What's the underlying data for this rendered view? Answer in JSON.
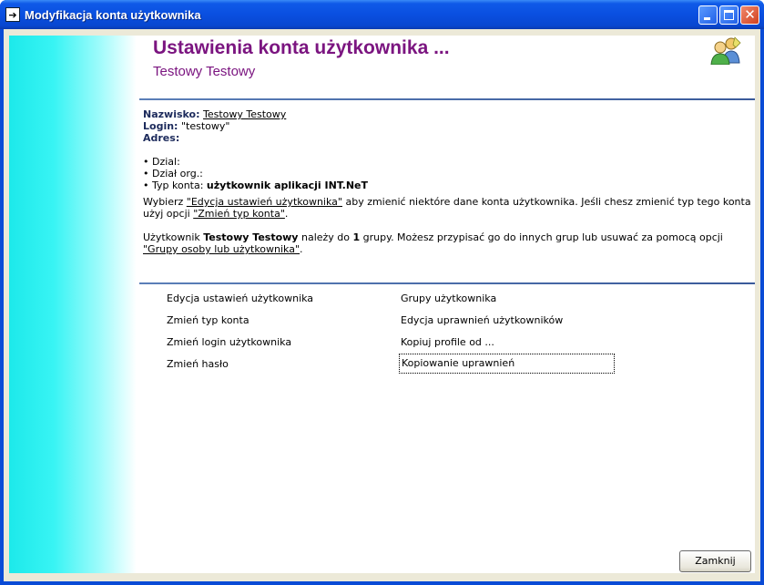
{
  "window": {
    "title": "Modyfikacja konta użytkownika",
    "app_icon": "app-icon",
    "controls": [
      "minimize-icon",
      "maximize-icon",
      "close-icon"
    ]
  },
  "header": {
    "title": "Ustawienia konta użytkownika ...",
    "subtitle": "Testowy Testowy",
    "icon": "users-icon"
  },
  "details": {
    "surname_label": "Nazwisko:",
    "surname_value": "Testowy Testowy",
    "login_label": "Login:",
    "login_value": "\"testowy\"",
    "address_label": "Adres:",
    "bullets": {
      "dzial": "• Dzial:",
      "dzial_org": "• Dział org.:",
      "typ_konta_label": "• Typ konta:",
      "typ_konta_value": "użytkownik aplikacji INT.NeT"
    }
  },
  "paragraph1": {
    "t1": "Wybierz ",
    "link1": "\"Edycja ustawień użytkownika\"",
    "t2": " aby zmienić niektóre dane konta użytkownika. Jeśli chesz zmienić typ tego konta użyj opcji ",
    "link2": "\"Zmień typ konta\"",
    "t3": "."
  },
  "paragraph2": {
    "t1": "Użytkownik ",
    "user": "Testowy Testowy",
    "t2": " należy do ",
    "count": "1",
    "t3": " grupy. Możesz przypisać go do innych grup lub usuwać za pomocą opcji ",
    "link": "\"Grupy osoby lub użytkownika\"",
    "t4": "."
  },
  "actions": {
    "left": [
      "Edycja ustawień użytkownika",
      "Zmień typ konta",
      "Zmień login użytkownika",
      "Zmień hasło"
    ],
    "right": [
      "Grupy użytkownika",
      "Edycja uprawnień użytkowników",
      "Kopiuj profile od ...",
      "Kopiowanie uprawnień"
    ]
  },
  "footer": {
    "close_label": "Zamknij"
  }
}
